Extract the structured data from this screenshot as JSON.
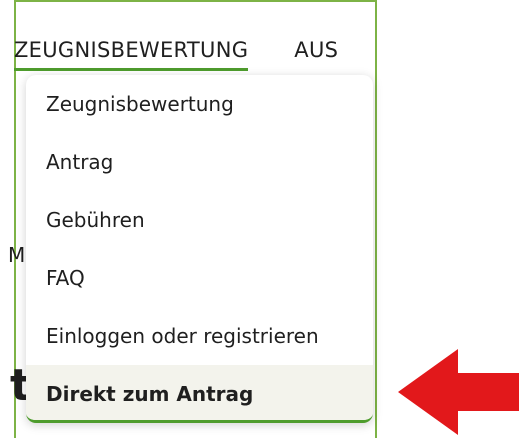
{
  "nav": {
    "items": [
      {
        "label": "ZEUGNISBEWERTUNG"
      },
      {
        "label": "AUS"
      }
    ]
  },
  "background": {
    "letter_m": "M",
    "letter_t": "t"
  },
  "dropdown": {
    "items": [
      {
        "label": "Zeugnisbewertung"
      },
      {
        "label": "Antrag"
      },
      {
        "label": "Gebühren"
      },
      {
        "label": "FAQ"
      },
      {
        "label": "Einloggen oder registrieren"
      },
      {
        "label": "Direkt zum Antrag"
      }
    ]
  },
  "colors": {
    "accent_green": "#4e9c2d",
    "frame_green": "#7db346",
    "arrow_red": "#e2181b",
    "highlight_bg": "#f3f3ec"
  },
  "icons": {
    "pointer": "red-left-arrow-icon"
  }
}
